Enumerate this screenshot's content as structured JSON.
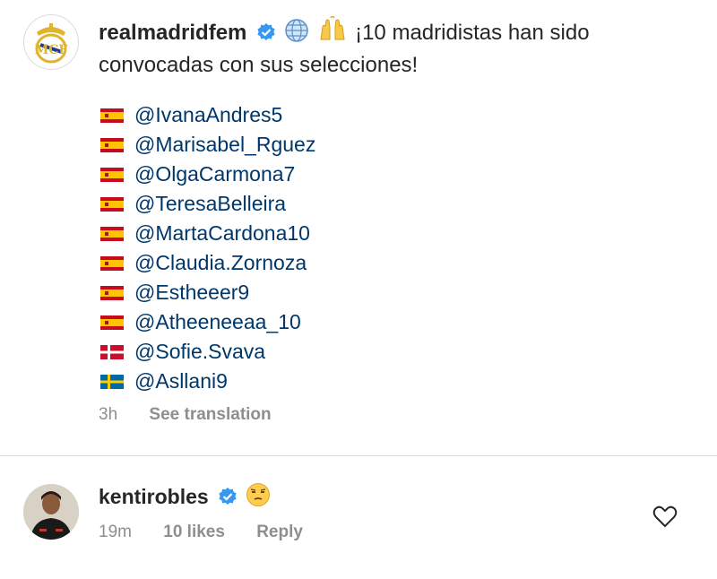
{
  "post": {
    "username": "realmadridfem",
    "caption_text": "¡10 madridistas han sido convocadas con sus selecciones!",
    "mentions": [
      {
        "flag": "es",
        "handle": "@IvanaAndres5"
      },
      {
        "flag": "es",
        "handle": "@Marisabel_Rguez"
      },
      {
        "flag": "es",
        "handle": "@OlgaCarmona7"
      },
      {
        "flag": "es",
        "handle": "@TeresaBelleira"
      },
      {
        "flag": "es",
        "handle": "@MartaCardona10"
      },
      {
        "flag": "es",
        "handle": "@Claudia.Zornoza"
      },
      {
        "flag": "es",
        "handle": "@Estheeer9"
      },
      {
        "flag": "es",
        "handle": "@Atheeneeaa_10"
      },
      {
        "flag": "dk",
        "handle": "@Sofie.Svava"
      },
      {
        "flag": "se",
        "handle": "@Asllani9"
      }
    ],
    "time": "3h",
    "see_translation": "See translation"
  },
  "comment": {
    "username": "kentirobles",
    "emoji": "unamused-face",
    "time": "19m",
    "likes": "10 likes",
    "reply": "Reply"
  },
  "icons": [
    "verified-badge-icon",
    "globe-icon",
    "raised-hands-icon",
    "heart-icon"
  ],
  "colors": {
    "verified": "#3897f0",
    "link": "#00376b",
    "muted": "#8e8e8e"
  }
}
